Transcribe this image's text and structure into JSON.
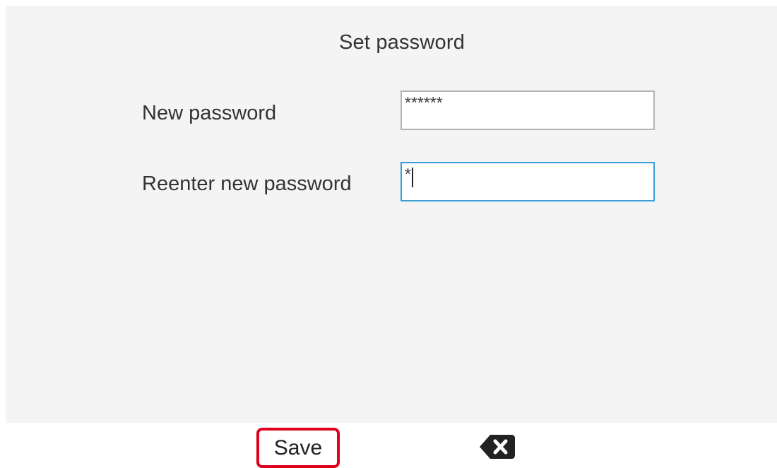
{
  "header": {
    "title": "Set password"
  },
  "form": {
    "new_password": {
      "label": "New password",
      "value": "******"
    },
    "reenter_password": {
      "label": "Reenter new password",
      "value": "*"
    }
  },
  "softkeys": {
    "save_label": "Save",
    "backspace_icon": "backspace-icon"
  },
  "colors": {
    "panel_background": "#f4f4f4",
    "focus_border": "#3a9fd6",
    "highlight_red": "#e0001b",
    "text": "#333333"
  }
}
